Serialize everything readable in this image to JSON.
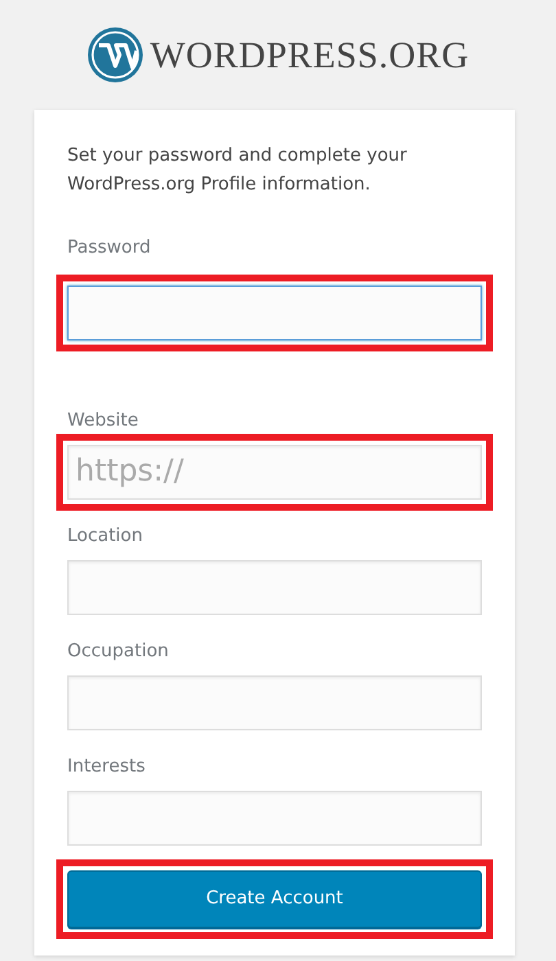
{
  "logo": {
    "text": "WORDPRESS.ORG"
  },
  "intro": "Set your password and complete your WordPress.org Profile information.",
  "fields": [
    {
      "kind": "password",
      "label": "Password",
      "focused": true,
      "highlighted": true
    },
    {
      "kind": "text",
      "label": "Website",
      "placeholder": "https://",
      "focused": false,
      "highlighted": true
    },
    {
      "kind": "text",
      "label": "Location",
      "focused": false,
      "highlighted": false
    },
    {
      "kind": "text",
      "label": "Occupation",
      "focused": false,
      "highlighted": false
    },
    {
      "kind": "text",
      "label": "Interests",
      "focused": false,
      "highlighted": false
    }
  ],
  "button": {
    "label": "Create Account",
    "highlighted": true
  }
}
